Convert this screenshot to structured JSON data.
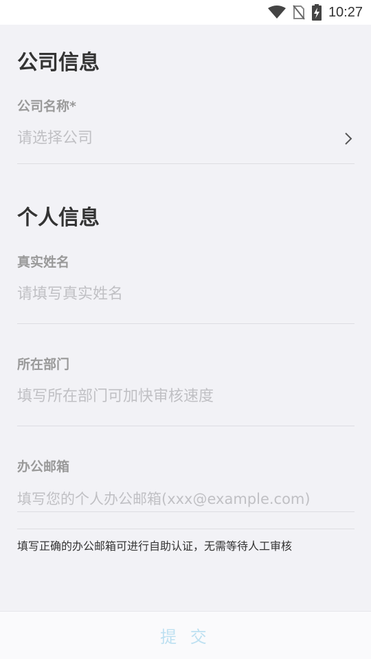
{
  "status_bar": {
    "time": "10:27",
    "icons": [
      "wifi-icon",
      "no-sim-icon",
      "battery-charging-icon"
    ]
  },
  "company_section": {
    "title": "公司信息",
    "company_name": {
      "label": "公司名称*",
      "placeholder": "请选择公司",
      "chevron_icon": "chevron-right-icon"
    }
  },
  "personal_section": {
    "title": "个人信息",
    "real_name": {
      "label": "真实姓名",
      "placeholder": "请填写真实姓名"
    },
    "department": {
      "label": "所在部门",
      "placeholder": "填写所在部门可加快审核速度"
    },
    "office_email": {
      "label": "办公邮箱",
      "placeholder": "填写您的个人办公邮箱(xxx@example.com)",
      "hint": "填写正确的办公邮箱可进行自助认证，无需等待人工审核"
    }
  },
  "submit": {
    "label": "提 交"
  },
  "colors": {
    "background": "#f2f2f6",
    "title": "#333333",
    "label": "#999999",
    "placeholder": "#c0c0c4",
    "submit_text": "#bde0f1"
  }
}
